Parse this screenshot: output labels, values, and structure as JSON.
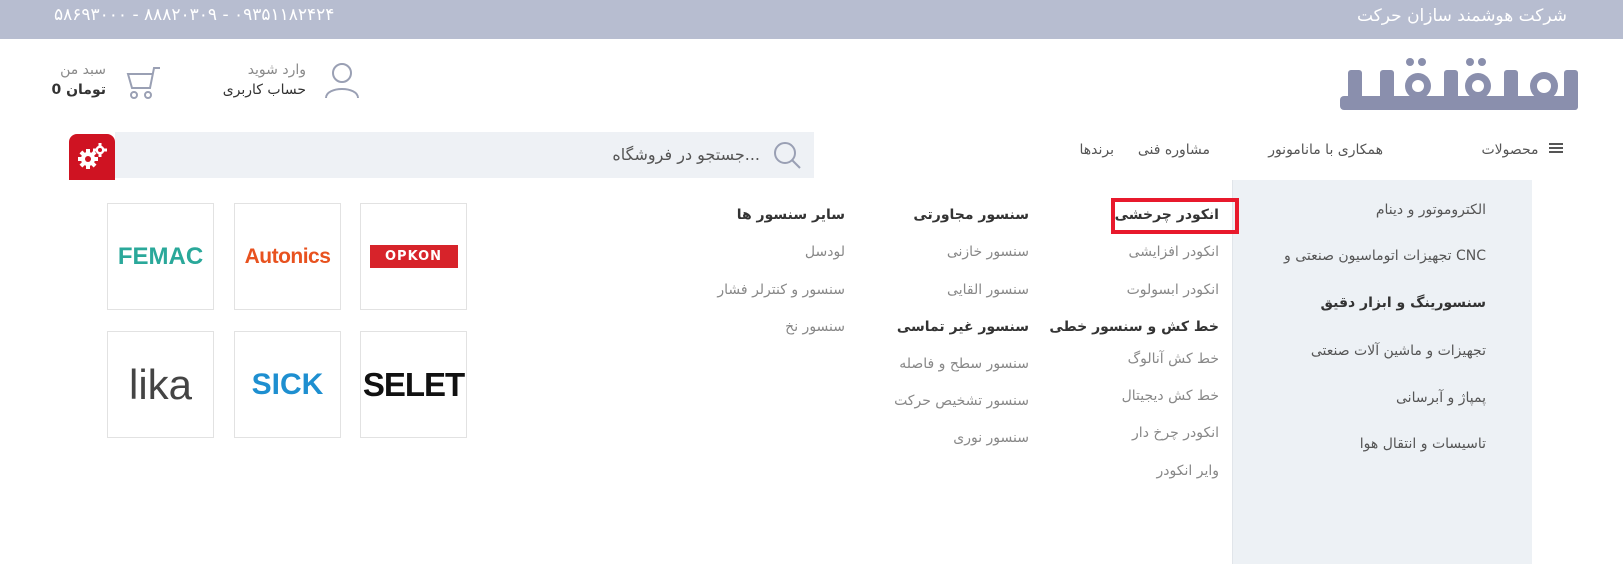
{
  "topbar": {
    "company": "شرکت هوشمند سازان حرکت",
    "phones": "۵۸۶۹۳۰۰۰ - ۸۸۸۲۰۳۰۹ - ۰۹۳۵۱۱۸۲۴۲۴"
  },
  "logo": {
    "text": "مانامونور"
  },
  "account": {
    "line1": "وارد شوید",
    "line2": "حساب کاربری"
  },
  "cart": {
    "line1": "سبد من",
    "line2": "0 تومان"
  },
  "nav": {
    "products": "محصولات",
    "cooperation": "همکاری با مانامونور",
    "consulting": "مشاوره فنی",
    "brands": "برندها"
  },
  "search": {
    "placeholder": "جستجو در فروشگاه..."
  },
  "sidebar": {
    "items": [
      {
        "label": "الکتروموتور و دینام"
      },
      {
        "label": "تجهیزات اتوماسیون صنعتی و CNC"
      },
      {
        "label": "سنسورینگ و ابزار دقیق"
      },
      {
        "label": "تجهیزات و ماشین آلات صنعتی"
      },
      {
        "label": "پمپاژ و آبرسانی"
      },
      {
        "label": "تاسیسات و انتقال هوا"
      }
    ]
  },
  "menu": {
    "col1": {
      "head1": "انکودر چرخشی",
      "links1": [
        "انکودر افزایشی",
        "انکودر ابسولوت"
      ],
      "head2": "خط کش و سنسور خطی",
      "links2": [
        "خط کش آنالوگ",
        "خط کش دیجیتال",
        "انکودر چرخ دار",
        "وایر انکودر"
      ]
    },
    "col2": {
      "head1": "سنسور مجاورتی",
      "links1": [
        "سنسور خازنی",
        "سنسور القایی"
      ],
      "head2": "سنسور غیر تماسی",
      "links2": [
        "سنسور سطح و فاصله",
        "سنسور تشخیص حرکت",
        "سنسور نوری"
      ]
    },
    "col3": {
      "head1": "سایر سنسور ها",
      "links1": [
        "لودسل",
        "سنسور و کنترلر فشار",
        "سنسور نخ"
      ]
    }
  },
  "brands": [
    "OPKON",
    "Autonics",
    "FEMAC",
    "SELET",
    "SICK",
    "lika"
  ],
  "colors": {
    "topbar": "#b7bdd0",
    "logo": "#8a8fad",
    "highlight": "#e8192c",
    "gear_button": "#cf1322",
    "sidebar_bg": "#edf1f5"
  }
}
